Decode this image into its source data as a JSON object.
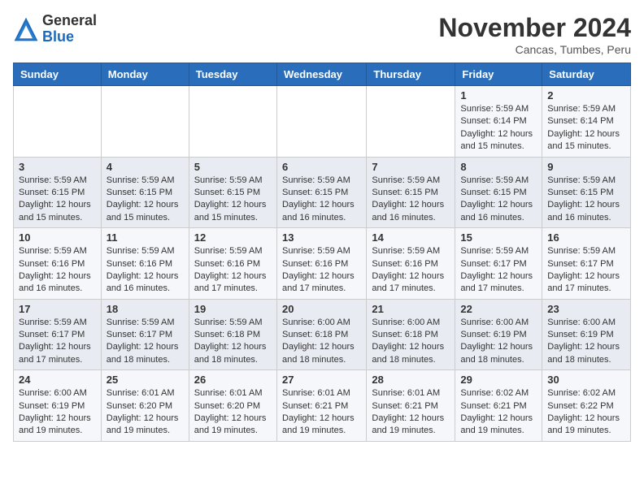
{
  "logo": {
    "general": "General",
    "blue": "Blue"
  },
  "title": "November 2024",
  "location": "Cancas, Tumbes, Peru",
  "weekdays": [
    "Sunday",
    "Monday",
    "Tuesday",
    "Wednesday",
    "Thursday",
    "Friday",
    "Saturday"
  ],
  "weeks": [
    [
      {
        "day": "",
        "info": ""
      },
      {
        "day": "",
        "info": ""
      },
      {
        "day": "",
        "info": ""
      },
      {
        "day": "",
        "info": ""
      },
      {
        "day": "",
        "info": ""
      },
      {
        "day": "1",
        "info": "Sunrise: 5:59 AM\nSunset: 6:14 PM\nDaylight: 12 hours\nand 15 minutes."
      },
      {
        "day": "2",
        "info": "Sunrise: 5:59 AM\nSunset: 6:14 PM\nDaylight: 12 hours\nand 15 minutes."
      }
    ],
    [
      {
        "day": "3",
        "info": "Sunrise: 5:59 AM\nSunset: 6:15 PM\nDaylight: 12 hours\nand 15 minutes."
      },
      {
        "day": "4",
        "info": "Sunrise: 5:59 AM\nSunset: 6:15 PM\nDaylight: 12 hours\nand 15 minutes."
      },
      {
        "day": "5",
        "info": "Sunrise: 5:59 AM\nSunset: 6:15 PM\nDaylight: 12 hours\nand 15 minutes."
      },
      {
        "day": "6",
        "info": "Sunrise: 5:59 AM\nSunset: 6:15 PM\nDaylight: 12 hours\nand 16 minutes."
      },
      {
        "day": "7",
        "info": "Sunrise: 5:59 AM\nSunset: 6:15 PM\nDaylight: 12 hours\nand 16 minutes."
      },
      {
        "day": "8",
        "info": "Sunrise: 5:59 AM\nSunset: 6:15 PM\nDaylight: 12 hours\nand 16 minutes."
      },
      {
        "day": "9",
        "info": "Sunrise: 5:59 AM\nSunset: 6:15 PM\nDaylight: 12 hours\nand 16 minutes."
      }
    ],
    [
      {
        "day": "10",
        "info": "Sunrise: 5:59 AM\nSunset: 6:16 PM\nDaylight: 12 hours\nand 16 minutes."
      },
      {
        "day": "11",
        "info": "Sunrise: 5:59 AM\nSunset: 6:16 PM\nDaylight: 12 hours\nand 16 minutes."
      },
      {
        "day": "12",
        "info": "Sunrise: 5:59 AM\nSunset: 6:16 PM\nDaylight: 12 hours\nand 17 minutes."
      },
      {
        "day": "13",
        "info": "Sunrise: 5:59 AM\nSunset: 6:16 PM\nDaylight: 12 hours\nand 17 minutes."
      },
      {
        "day": "14",
        "info": "Sunrise: 5:59 AM\nSunset: 6:16 PM\nDaylight: 12 hours\nand 17 minutes."
      },
      {
        "day": "15",
        "info": "Sunrise: 5:59 AM\nSunset: 6:17 PM\nDaylight: 12 hours\nand 17 minutes."
      },
      {
        "day": "16",
        "info": "Sunrise: 5:59 AM\nSunset: 6:17 PM\nDaylight: 12 hours\nand 17 minutes."
      }
    ],
    [
      {
        "day": "17",
        "info": "Sunrise: 5:59 AM\nSunset: 6:17 PM\nDaylight: 12 hours\nand 17 minutes."
      },
      {
        "day": "18",
        "info": "Sunrise: 5:59 AM\nSunset: 6:17 PM\nDaylight: 12 hours\nand 18 minutes."
      },
      {
        "day": "19",
        "info": "Sunrise: 5:59 AM\nSunset: 6:18 PM\nDaylight: 12 hours\nand 18 minutes."
      },
      {
        "day": "20",
        "info": "Sunrise: 6:00 AM\nSunset: 6:18 PM\nDaylight: 12 hours\nand 18 minutes."
      },
      {
        "day": "21",
        "info": "Sunrise: 6:00 AM\nSunset: 6:18 PM\nDaylight: 12 hours\nand 18 minutes."
      },
      {
        "day": "22",
        "info": "Sunrise: 6:00 AM\nSunset: 6:19 PM\nDaylight: 12 hours\nand 18 minutes."
      },
      {
        "day": "23",
        "info": "Sunrise: 6:00 AM\nSunset: 6:19 PM\nDaylight: 12 hours\nand 18 minutes."
      }
    ],
    [
      {
        "day": "24",
        "info": "Sunrise: 6:00 AM\nSunset: 6:19 PM\nDaylight: 12 hours\nand 19 minutes."
      },
      {
        "day": "25",
        "info": "Sunrise: 6:01 AM\nSunset: 6:20 PM\nDaylight: 12 hours\nand 19 minutes."
      },
      {
        "day": "26",
        "info": "Sunrise: 6:01 AM\nSunset: 6:20 PM\nDaylight: 12 hours\nand 19 minutes."
      },
      {
        "day": "27",
        "info": "Sunrise: 6:01 AM\nSunset: 6:21 PM\nDaylight: 12 hours\nand 19 minutes."
      },
      {
        "day": "28",
        "info": "Sunrise: 6:01 AM\nSunset: 6:21 PM\nDaylight: 12 hours\nand 19 minutes."
      },
      {
        "day": "29",
        "info": "Sunrise: 6:02 AM\nSunset: 6:21 PM\nDaylight: 12 hours\nand 19 minutes."
      },
      {
        "day": "30",
        "info": "Sunrise: 6:02 AM\nSunset: 6:22 PM\nDaylight: 12 hours\nand 19 minutes."
      }
    ]
  ]
}
